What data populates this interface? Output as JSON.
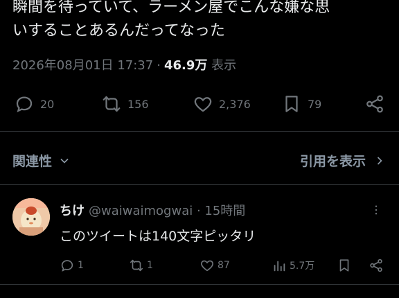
{
  "tweet": {
    "text_line1": "瞬間を待っていて、ラーメン屋でこんな嫌な思",
    "text_line2": "いすることあるんだってなった",
    "datetime": "2026年08月01日 17:37",
    "views_count": "46.9万",
    "views_label": "表示"
  },
  "actions": {
    "reply_count": "20",
    "retweet_count": "156",
    "like_count": "2,376",
    "bookmark_count": "79"
  },
  "sort": {
    "label": "関連性",
    "quotes_label": "引用を表示"
  },
  "reply": {
    "name": "ちけ",
    "handle": "@waiwaimogwai",
    "time": "15時間",
    "text": "このツイートは140文字ピッタリ",
    "reply_count": "1",
    "retweet_count": "1",
    "like_count": "87",
    "views_count": "5.7万"
  },
  "colors": {
    "background": "#000000",
    "text": "#e7e9ea",
    "muted": "#71767b",
    "divider": "#2f3336"
  }
}
